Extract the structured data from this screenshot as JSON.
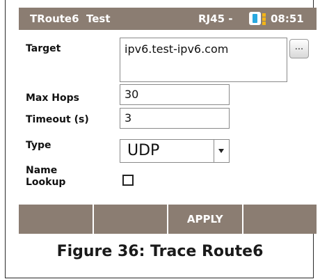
{
  "status_bar": {
    "title": "TRoute6  Test",
    "connection": "RJ45 -",
    "time": "08:51",
    "battery_icon": "battery-icon"
  },
  "form": {
    "target": {
      "label": "Target",
      "value": "ipv6.test-ipv6.com",
      "browse_label": "..."
    },
    "max_hops": {
      "label": "Max Hops",
      "value": "30"
    },
    "timeout": {
      "label": "Timeout (s)",
      "value": "3"
    },
    "type": {
      "label": "Type",
      "value": "UDP"
    },
    "name_lookup": {
      "label_line1": "Name",
      "label_line2": "Lookup",
      "checked": false
    }
  },
  "softkeys": [
    "",
    "",
    "APPLY",
    ""
  ],
  "caption": "Figure 36: Trace Route6",
  "colors": {
    "bar": "#8b7d72",
    "battery_blue": "#2aa9e0",
    "battery_yellow": "#f2b418"
  }
}
